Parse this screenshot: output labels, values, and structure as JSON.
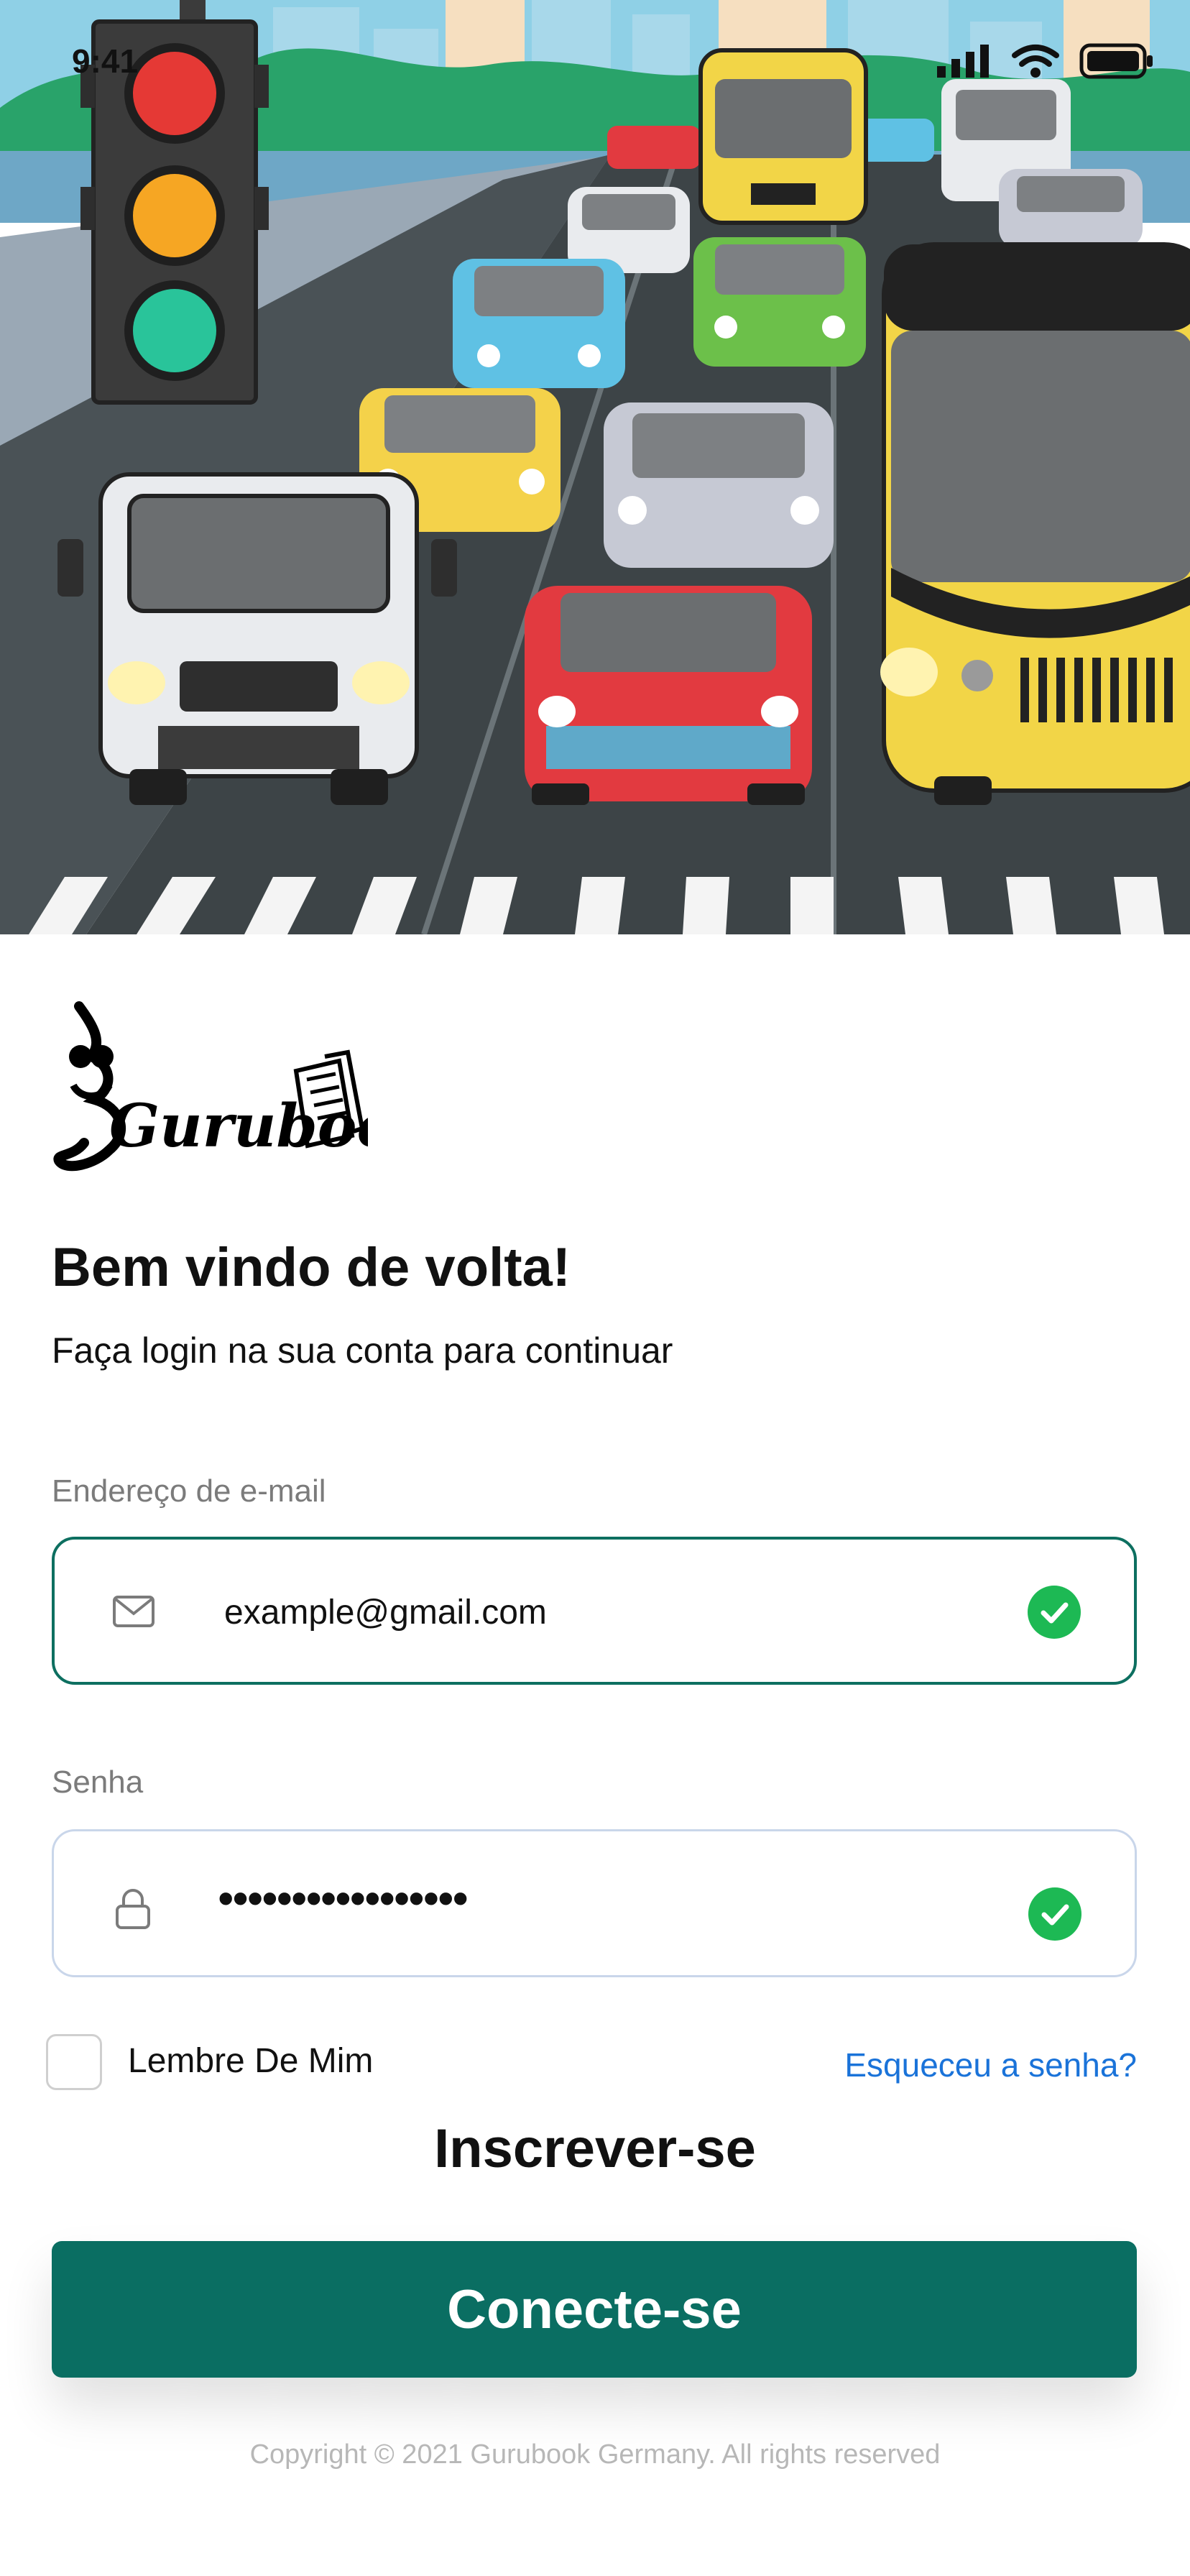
{
  "status_bar": {
    "time": "9:41",
    "icons": [
      "signal-icon",
      "wifi-icon",
      "battery-icon"
    ]
  },
  "hero": {
    "illustration": "traffic-illustration"
  },
  "brand": {
    "logo_text": "Gurubook"
  },
  "header": {
    "title": "Bem vindo de volta!",
    "subtitle": "Faça login na sua conta para continuar"
  },
  "form": {
    "email": {
      "label": "Endereço de e-mail",
      "value": "example@gmail.com",
      "icon": "mail-icon",
      "status_icon": "check-icon"
    },
    "password": {
      "label": "Senha",
      "value": "•••••••••••••••••",
      "icon": "lock-icon",
      "status_icon": "check-icon"
    },
    "remember_label": "Lembre De Mim",
    "forgot_label": "Esqueceu a senha?",
    "signup_label": "Inscrever-se",
    "login_label": "Conecte-se"
  },
  "footer": {
    "copyright": "Copyright © 2021 Gurubook Germany. All rights reserved"
  },
  "colors": {
    "primary": "#0a6e62",
    "success": "#1db954",
    "link": "#1a73d9",
    "muted": "#7b7b7b"
  }
}
